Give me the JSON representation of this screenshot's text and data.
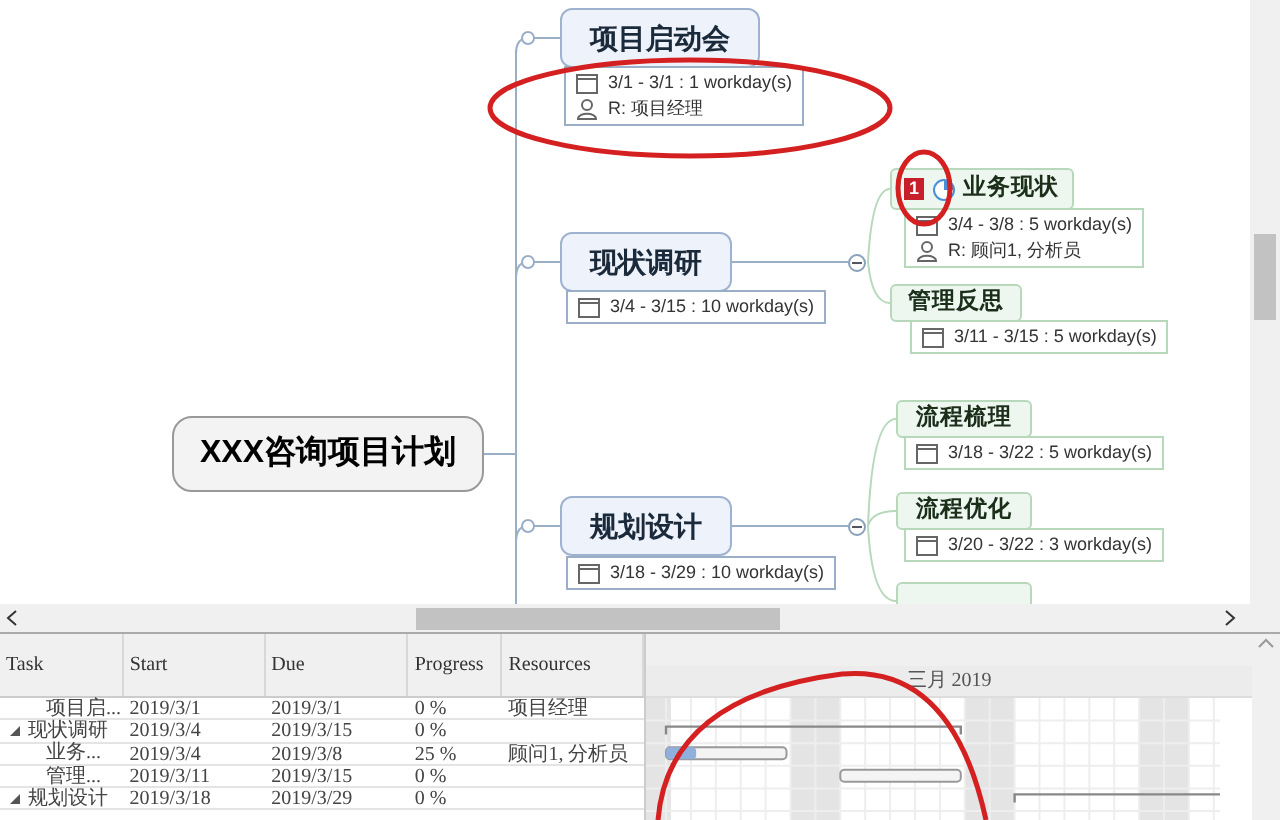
{
  "mindmap": {
    "root": {
      "title": "XXX咨询项目计划"
    },
    "branches": [
      {
        "title": "项目启动会",
        "dates": "3/1 - 3/1 : 1 workday(s)",
        "resources": "R: 项目经理"
      },
      {
        "title": "现状调研",
        "dates": "3/4 - 3/15 : 10 workday(s)",
        "expanded": true,
        "children": [
          {
            "kind": "topic",
            "title": "业务现状",
            "priority": "1",
            "level": 0.25,
            "dates": "3/4 - 3/8 : 5 workday(s)",
            "resources": "R: 顾问1, 分析员"
          },
          {
            "kind": "topic",
            "title": "管理反思",
            "dates": "3/11 - 3/15 : 5 workday(s)"
          }
        ]
      },
      {
        "title": "规划设计",
        "dates": "3/18 - 3/29 : 10 workday(s)",
        "expanded": true,
        "children": [
          {
            "kind": "topic",
            "title": "流程梳理",
            "dates": "3/18 - 3/22 : 5 workday(s)"
          },
          {
            "kind": "topic",
            "title": "流程优化",
            "dates": "3/20 - 3/22 : 3 workday(s)"
          },
          {
            "kind": "topic"
          }
        ]
      }
    ]
  },
  "gantt": {
    "columns": [
      "Task",
      "Start",
      "Due",
      "Progress",
      "Resources"
    ],
    "month": "三月 2019",
    "rows": [
      {
        "kind": "task",
        "task": "项目启...",
        "start": "2019/3/1",
        "due": "2019/3/1",
        "progress": "0 %",
        "resources": "项目经理"
      },
      {
        "kind": "summary",
        "expanded": true,
        "task": "现状调研",
        "start": "2019/3/4",
        "due": "2019/3/15",
        "progress": "0 %"
      },
      {
        "kind": "task",
        "task": "业务...",
        "start": "2019/3/4",
        "due": "2019/3/8",
        "progress": "25 %",
        "level": 0.25,
        "resources": "顾问1, 分析员"
      },
      {
        "kind": "task",
        "task": "管理...",
        "start": "2019/3/11",
        "due": "2019/3/15",
        "progress": "0 %"
      },
      {
        "kind": "summary",
        "expanded": true,
        "task": "规划设计",
        "start": "2019/3/18",
        "due": "2019/3/29",
        "progress": "0 %"
      }
    ]
  }
}
